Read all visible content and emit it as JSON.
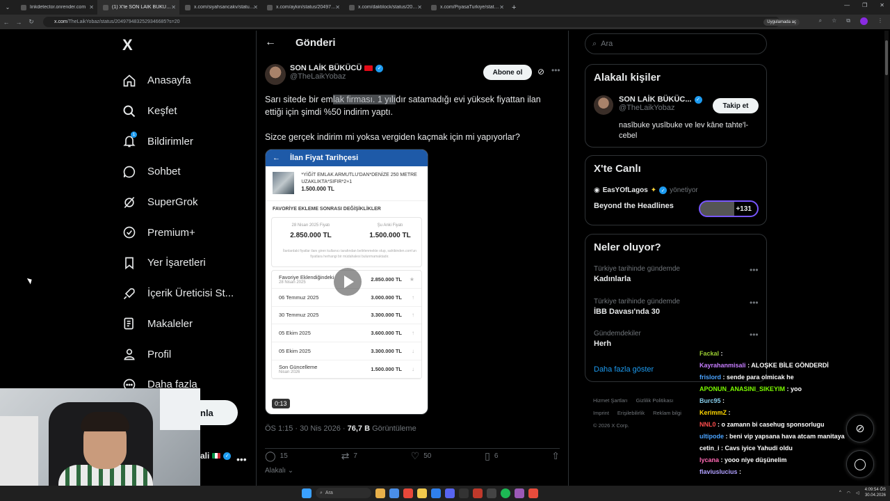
{
  "browser": {
    "tabs": [
      {
        "label": "linkdetector.onrender.com",
        "active": false
      },
      {
        "label": "(1) X'te SON LAİK BÜKÜCÜ 'te",
        "active": true
      },
      {
        "label": "x.com/siyahsancakv/status/204",
        "active": false
      },
      {
        "label": "x.com/aykiri/status/2049757598",
        "active": false
      },
      {
        "label": "x.com/daktilock/status/20495",
        "active": false
      },
      {
        "label": "x.com/PiyasaTurkiye/status/204",
        "active": false
      }
    ],
    "url_host": "x.com",
    "url_path": "/TheLaikYobaz/status/2049794832529346685?s=20",
    "app_button": "Uygulamada aç"
  },
  "nav": {
    "logo": "X",
    "items": [
      {
        "label": "Anasayfa",
        "icon": "home-icon"
      },
      {
        "label": "Keşfet",
        "icon": "search-icon"
      },
      {
        "label": "Bildirimler",
        "icon": "bell-icon",
        "badge": "1"
      },
      {
        "label": "Sohbet",
        "icon": "chat-icon"
      },
      {
        "label": "SuperGrok",
        "icon": "grok-icon"
      },
      {
        "label": "Premium+",
        "icon": "premium-icon"
      },
      {
        "label": "Yer İşaretleri",
        "icon": "bookmark-icon"
      },
      {
        "label": "İçerik Üreticisi St...",
        "icon": "rocket-icon"
      },
      {
        "label": "Makaleler",
        "icon": "article-icon"
      },
      {
        "label": "Profil",
        "icon": "profile-icon"
      },
      {
        "label": "Daha fazla",
        "icon": "more-circle-icon"
      }
    ],
    "post_button_partial": "nla",
    "account_partial": "ali"
  },
  "post": {
    "header_title": "Gönderi",
    "author_name": "SON LAİK BÜKÜCÜ",
    "author_handle": "@TheLaikYobaz",
    "subscribe_label": "Abone ol",
    "text_line1_pre": "Sarı sitede bir em",
    "text_line1_hl": "lak firması. 1 yılı",
    "text_line1_post": "dır satamadığı evi yüksek fiyattan ilan",
    "text_line2": "ettiği için şimdi %50 indirim yaptı.",
    "text_para2": "Sizce gerçek indirim mi yoksa vergiden kaçmak için mi yapıyorlar?",
    "meta_time": "ÖS 1:15 · 30 Nis 2026 · ",
    "meta_views": "76,7 B",
    "meta_views_label": " Görüntüleme",
    "replies": "15",
    "reposts": "7",
    "likes": "50",
    "bookmarks": "6",
    "relevant_label": "Alakalı"
  },
  "media": {
    "header": "İlan Fiyat Tarihçesi",
    "listing_title": "*YİĞİT EMLAK ARMUTLU'DAN*DENİZE 250 METRE UZAKLIKTA*SIFIR*2+1",
    "listing_price": "1.500.000 TL",
    "section_title": "FAVORİYE EKLEME SONRASI DEĞİŞİKLİKLER",
    "cmp_label1": "28 Nisan 2025 Fiyatı",
    "cmp_value1": "2.850.000 TL",
    "cmp_label2": "Şu Anki Fiyatı",
    "cmp_value2": "1.500.000 TL",
    "cmp_note": "İlanlardaki fiyatlar ilanı giren kullanıcı tarafından belirlenmekte olup, sahibinden.com'un fiyatlara herhangi bir müdahalesi bulunmamaktadır.",
    "history": [
      {
        "date": "Favoriye Eklendiğindeki",
        "sub": "28 Nisan 2025",
        "value": "2.850.000 TL",
        "arrow": "★"
      },
      {
        "date": "06 Temmuz 2025",
        "sub": "",
        "value": "3.000.000 TL",
        "arrow": "↑"
      },
      {
        "date": "30 Temmuz 2025",
        "sub": "",
        "value": "3.300.000 TL",
        "arrow": "↑"
      },
      {
        "date": "05 Ekim 2025",
        "sub": "",
        "value": "3.600.000 TL",
        "arrow": "↑"
      },
      {
        "date": "05 Ekim 2025",
        "sub": "",
        "value": "3.300.000 TL",
        "arrow": "↓"
      },
      {
        "date": "Son Güncelleme",
        "sub": "Nisan 2026",
        "value": "1.500.000 TL",
        "arrow": "↓"
      }
    ],
    "duration": "0:13"
  },
  "right": {
    "search_placeholder": "Ara",
    "related_title": "Alakalı kişiler",
    "related_name": "SON LAİK BÜKÜC...",
    "related_handle": "@TheLaikYobaz",
    "follow_label": "Takip et",
    "related_bio": "nasîbuke yusîbuke ve lev kâne tahte'l-cebel",
    "live_title": "X'te Canlı",
    "live_host": "EasYOfLagos",
    "live_role": "yönetiyor",
    "live_show": "Beyond the Headlines",
    "live_count": "+131",
    "trends_title": "Neler oluyor?",
    "trends": [
      {
        "context": "Türkiye tarihinde gündemde",
        "name": "Kadınlarla"
      },
      {
        "context": "Türkiye tarihinde gündemde",
        "name": "İBB Davası'nda 30"
      },
      {
        "context": "Gündemdekiler",
        "name": "Herh"
      }
    ],
    "show_more": "Daha fazla göster",
    "footer": [
      "Hizmet Şartları",
      "Gizlilik Politikası",
      "Imprint",
      "Erişilebilirlik",
      "Reklam bilgi",
      "© 2026 X Corp."
    ]
  },
  "chat": [
    {
      "user": "Fackal",
      "msg": ":",
      "color": "#9acd32"
    },
    {
      "user": "Kayrahanmisali",
      "msg": ": ALOŞKE BİLE GÖNDERDİ",
      "color": "#c77dff"
    },
    {
      "user": "frislord",
      "msg": ": sende para olmicak he",
      "color": "#4aa3ff"
    },
    {
      "user": "APONUN_ANASINI_SIKEYIM",
      "msg": ": yoo",
      "color": "#7CFC00"
    },
    {
      "user": "Burc95",
      "msg": ":",
      "color": "#87ceeb"
    },
    {
      "user": "KerimmZ",
      "msg": ":",
      "color": "#ffd700"
    },
    {
      "user": "NNL0",
      "msg": ": o zamann bi casehug sponsorlugu",
      "color": "#ff4d4d"
    },
    {
      "user": "ultipode",
      "msg": ": beni vip yapsana hava atcam manitaya",
      "color": "#4aa3ff"
    },
    {
      "user": "cetin_i",
      "msg": ": Cavs iyice Yahudi oldu",
      "color": "#ffffff"
    },
    {
      "user": "lycana",
      "msg": ": yooo niye düşünelim",
      "color": "#ff69b4"
    },
    {
      "user": "flaviuslucius",
      "msg": ":",
      "color": "#b0a0ff"
    }
  ],
  "taskbar": {
    "search": "Ara",
    "time": "4:09:54 ÖS",
    "date": "30.04.2026"
  },
  "colors": {
    "accent": "#1d9bf0",
    "background": "#000000",
    "border": "#2f3336",
    "muted": "#71767b"
  }
}
